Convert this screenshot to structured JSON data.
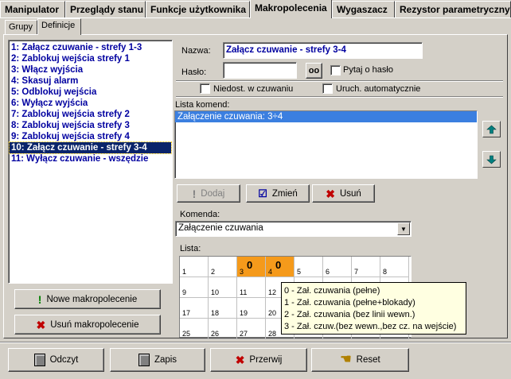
{
  "tabs": [
    "Manipulator",
    "Przeglądy stanu",
    "Funkcje użytkownika",
    "Makropolecenia",
    "Wygaszacz",
    "Rezystor parametryczny"
  ],
  "subtabs": [
    "Grupy",
    "Definicje"
  ],
  "macros": [
    "1: Załącz czuwanie - strefy 1-3",
    "2: Zablokuj wejścia strefy 1",
    "3: Włącz wyjścia",
    "4: Skasuj alarm",
    "5: Odblokuj wejścia",
    "6: Wyłącz wyjścia",
    "7: Zablokuj wejścia strefy 2",
    "8: Zablokuj wejścia strefy 3",
    "9: Zablokuj wejścia strefy 4",
    "10: Załącz czuwanie - strefy 3-4",
    "11: Wyłącz czuwanie - wszędzie"
  ],
  "selected_macro_index": 9,
  "buttons": {
    "new_macro": "Nowe makropolecenie",
    "delete_macro": "Usuń makropolecenie",
    "add": "Dodaj",
    "change": "Zmień",
    "remove": "Usuń",
    "read": "Odczyt",
    "write": "Zapis",
    "interrupt": "Przerwij",
    "reset": "Reset"
  },
  "form": {
    "name_label": "Nazwa:",
    "name_value": "Załącz czuwanie - strefy 3-4",
    "password_label": "Hasło:",
    "password_value": "",
    "ask_password_label": "Pytaj o hasło",
    "ask_password_checked": false,
    "not_available_label": "Niedost. w czuwaniu",
    "not_available_checked": false,
    "auto_start_label": "Uruch. automatycznie",
    "auto_start_checked": false
  },
  "command_list": {
    "label": "Lista komend:",
    "items": [
      "Załączenie czuwania: 3÷4"
    ]
  },
  "command": {
    "label": "Komenda:",
    "value": "Załączenie czuwania"
  },
  "list": {
    "label": "Lista:",
    "rows": [
      [
        {
          "n": "1",
          "v": ""
        },
        {
          "n": "2",
          "v": ""
        },
        {
          "n": "3",
          "v": "0"
        },
        {
          "n": "4",
          "v": "0"
        },
        {
          "n": "5",
          "v": ""
        },
        {
          "n": "6",
          "v": ""
        },
        {
          "n": "7",
          "v": ""
        },
        {
          "n": "8",
          "v": ""
        }
      ],
      [
        {
          "n": "9",
          "v": ""
        },
        {
          "n": "10",
          "v": ""
        },
        {
          "n": "11",
          "v": ""
        },
        {
          "n": "12",
          "v": ""
        },
        {
          "n": "",
          "v": ""
        },
        {
          "n": "",
          "v": ""
        },
        {
          "n": "",
          "v": ""
        },
        {
          "n": "",
          "v": ""
        }
      ],
      [
        {
          "n": "17",
          "v": ""
        },
        {
          "n": "18",
          "v": ""
        },
        {
          "n": "19",
          "v": ""
        },
        {
          "n": "20",
          "v": ""
        },
        {
          "n": "",
          "v": ""
        },
        {
          "n": "",
          "v": ""
        },
        {
          "n": "",
          "v": ""
        },
        {
          "n": "",
          "v": ""
        }
      ],
      [
        {
          "n": "25",
          "v": ""
        },
        {
          "n": "26",
          "v": ""
        },
        {
          "n": "27",
          "v": ""
        },
        {
          "n": "28",
          "v": ""
        },
        {
          "n": "",
          "v": ""
        },
        {
          "n": "",
          "v": ""
        },
        {
          "n": "",
          "v": ""
        },
        {
          "n": "",
          "v": ""
        }
      ]
    ],
    "highlight_color": "#f59a1b"
  },
  "tooltip": [
    "0 - Zał. czuwania (pełne)",
    "1 - Zał. czuwania (pełne+blokady)",
    "2 - Zał. czuwania (bez linii wewn.)",
    "3 - Zał. czuw.(bez wewn.,bez cz. na wejście)"
  ],
  "icons": {
    "new_macro": "exclamation-icon",
    "delete_macro": "x-icon",
    "add": "exclamation-icon",
    "change": "checkbox-icon",
    "remove": "x-icon",
    "read": "calculator-icon",
    "write": "calculator-icon",
    "interrupt": "x-icon",
    "reset": "hand-icon",
    "password_toggle": "glasses-icon",
    "move_up": "arrow-up-icon",
    "move_down": "arrow-down-icon"
  },
  "colors": {
    "selection": "#0a246a",
    "macro_text": "#0000a0",
    "command_selection": "#3b7fe0",
    "x_red": "#c00000",
    "tooltip_bg": "#ffffe1"
  }
}
